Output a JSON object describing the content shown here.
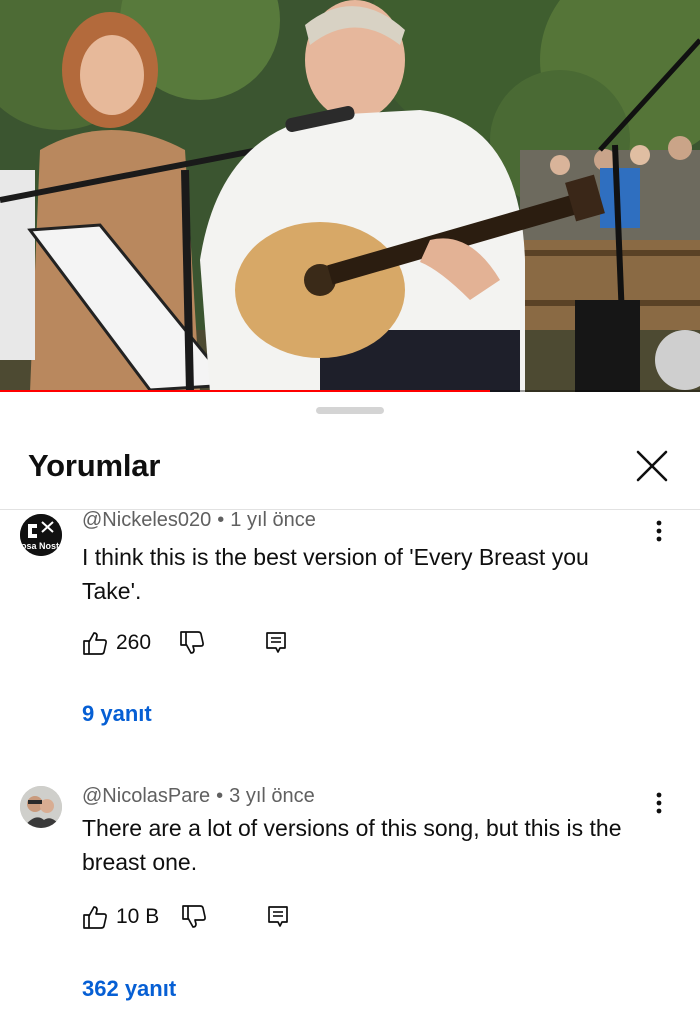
{
  "video": {
    "progress_fraction": 0.7,
    "accent_color": "#ff0000"
  },
  "sheet": {
    "title": "Yorumlar",
    "close_icon": "close-icon"
  },
  "comments": [
    {
      "author": "@Nickeles020",
      "time": "1 yıl önce",
      "text": "I think this is the best version of 'Every Breast you Take'.",
      "likes": "260",
      "replies": "9 yanıt",
      "avatar_text": "Cosa Nostra"
    },
    {
      "author": "@NicolasPare",
      "time": "3 yıl önce",
      "text": "There are a lot of versions of this song, but this is the breast one.",
      "likes": "10 B",
      "replies": "362 yanıt"
    }
  ],
  "icons": {
    "like": "thumbs-up-icon",
    "dislike": "thumbs-down-icon",
    "reply": "reply-icon",
    "more": "more-vert-icon"
  },
  "colors": {
    "link": "#065fd4",
    "meta": "#606060",
    "text": "#0f0f0f"
  }
}
